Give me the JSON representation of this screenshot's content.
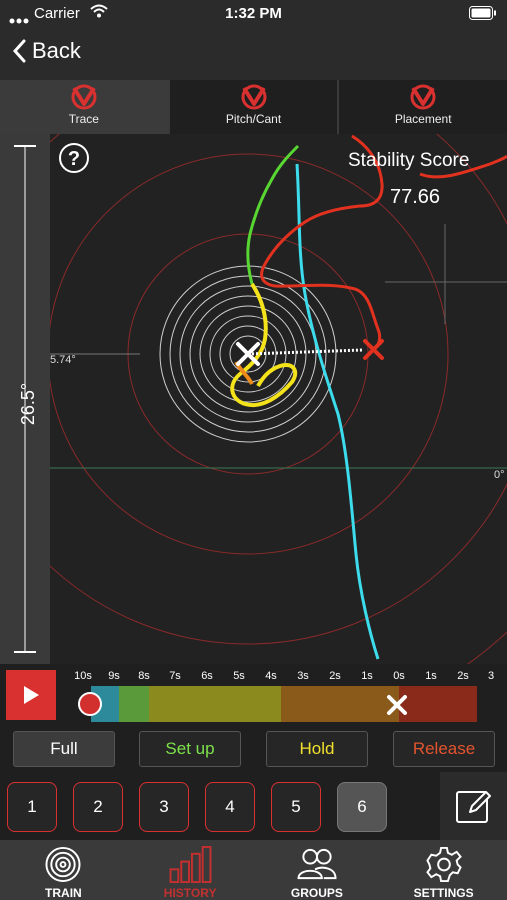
{
  "status": {
    "carrier": "Carrier",
    "time": "1:32 PM"
  },
  "nav": {
    "back_label": "Back"
  },
  "tabs": [
    {
      "label": "Trace",
      "icon": "v-logo-icon",
      "active": true
    },
    {
      "label": "Pitch/Cant",
      "icon": "v-logo-icon",
      "active": false
    },
    {
      "label": "Placement",
      "icon": "v-logo-icon",
      "active": false
    }
  ],
  "plot": {
    "scale_label": "26.5°",
    "stability_title": "Stability Score",
    "stability_value": "77.66",
    "left_angle": "5.74°",
    "right_angle": "0°"
  },
  "timeline": {
    "ticks": [
      "10s",
      "9s",
      "8s",
      "7s",
      "6s",
      "5s",
      "4s",
      "3s",
      "2s",
      "1s",
      "0s",
      "1s",
      "2s",
      "3"
    ]
  },
  "phases": {
    "full": "Full",
    "setup": "Set up",
    "hold": "Hold",
    "release": "Release"
  },
  "shots": [
    "1",
    "2",
    "3",
    "4",
    "5",
    "6"
  ],
  "active_shot": "6",
  "bottom_tabs": [
    {
      "label": "TRAIN",
      "icon": "target-icon"
    },
    {
      "label": "HISTORY",
      "icon": "bar-chart-icon"
    },
    {
      "label": "GROUPS",
      "icon": "people-icon"
    },
    {
      "label": "SETTINGS",
      "icon": "gear-icon"
    }
  ],
  "colors": {
    "accent_red": "#d93030",
    "setup_green": "#7ce24a",
    "hold_yellow": "#f2e02e",
    "release_orange": "#e3542e",
    "trace_cyan": "#3cdcec"
  }
}
